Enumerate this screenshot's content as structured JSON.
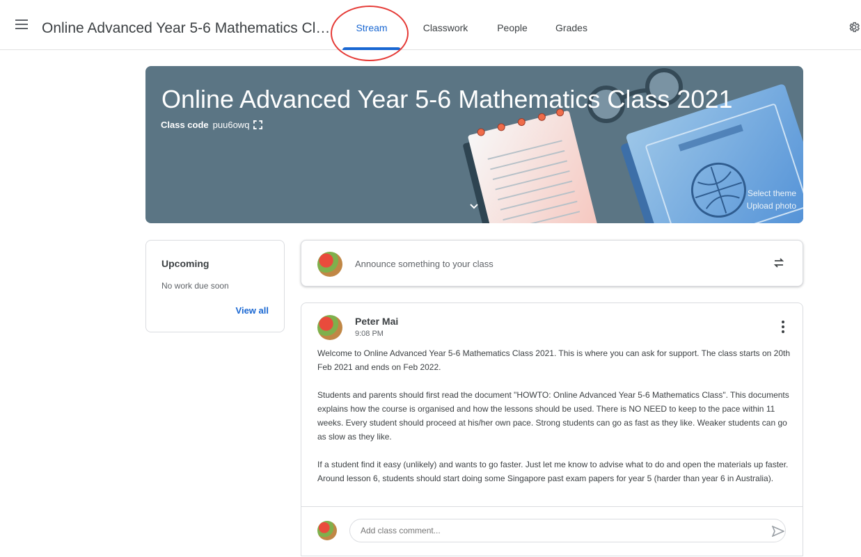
{
  "header": {
    "class_title": "Online Advanced Year 5-6 Mathematics Cla...",
    "tabs": [
      {
        "label": "Stream",
        "active": true
      },
      {
        "label": "Classwork",
        "active": false
      },
      {
        "label": "People",
        "active": false
      },
      {
        "label": "Grades",
        "active": false
      }
    ],
    "icons": {
      "menu": "hamburger-menu-icon",
      "settings": "gear-icon"
    },
    "accent_color": "#1967d2",
    "highlight_color": "#e53935"
  },
  "banner": {
    "title": "Online Advanced Year 5-6 Mathematics Class 2021",
    "class_code_label": "Class code",
    "class_code": "puu6owq",
    "select_theme": "Select theme",
    "upload_photo": "Upload photo",
    "background_color": "#5b7584"
  },
  "upcoming": {
    "title": "Upcoming",
    "status": "No work due soon",
    "view_all": "View all"
  },
  "announce": {
    "placeholder": "Announce something to your class"
  },
  "post": {
    "author": "Peter Mai",
    "time": "9:08 PM",
    "paragraphs": [
      "Welcome to Online Advanced Year 5-6 Mathematics Class 2021. This is where you can ask for support. The class starts on 20th Feb 2021 and ends on Feb 2022.",
      "Students and parents should first read the document \"HOWTO: Online Advanced Year 5-6 Mathematics Class\". This documents explains how the course is organised and how the lessons should be used. There is NO NEED to keep to the pace within 11 weeks. Every student should proceed at his/her own pace. Strong students can go as fast as they like. Weaker students can go as slow as they like.",
      "If a student find it easy (unlikely) and wants to go faster. Just let me know to advise what to do and open the materials up faster. Around lesson 6, students should start doing some Singapore past exam papers for year 5 (harder than year 6 in Australia)."
    ],
    "comment_placeholder": "Add class comment..."
  }
}
